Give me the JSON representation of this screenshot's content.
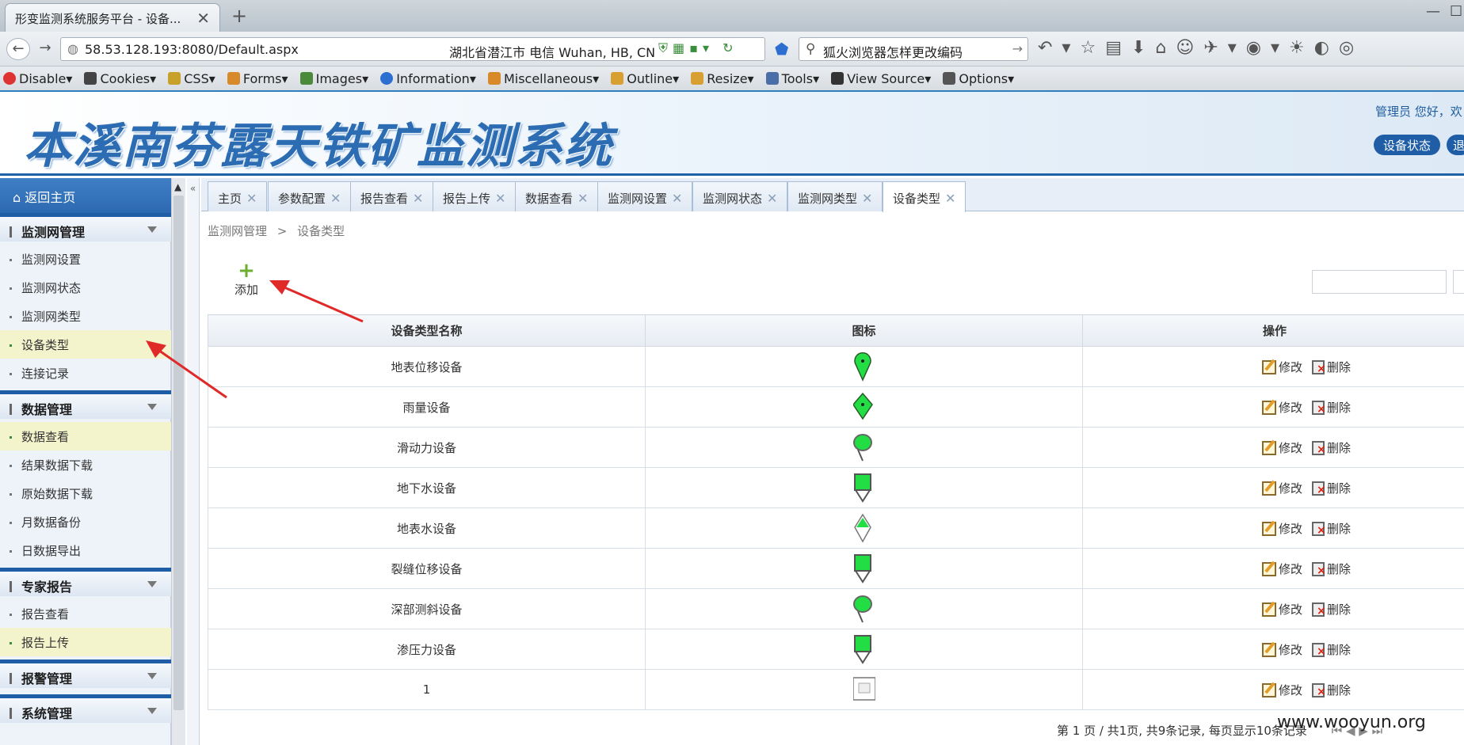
{
  "browser": {
    "tab_title": "形变监测系统服务平台 - 设备...",
    "url": "58.53.128.193:8080/Default.aspx",
    "geo": "湖北省潜江市 电信   Wuhan, HB, CN",
    "search_text": "狐火浏览器怎样更改编码",
    "dev_toolbar": [
      "Disable",
      "Cookies",
      "CSS",
      "Forms",
      "Images",
      "Information",
      "Miscellaneous",
      "Outline",
      "Resize",
      "Tools",
      "View Source",
      "Options"
    ],
    "dev_icon_colors": [
      "#d33",
      "#444",
      "#c8a12a",
      "#d88a2a",
      "#4a8a3a",
      "#2c6fd1",
      "#d8892a",
      "#d8a030",
      "#d8a030",
      "#4a6fa8",
      "#333",
      "#555"
    ]
  },
  "header": {
    "logo_text": "本溪南芬露天铁矿监测系统",
    "user_text": "管理员  您好，欢",
    "btn_status": "设备状态",
    "btn_exit": "退"
  },
  "sidebar": {
    "home": "返回主页",
    "groups": [
      {
        "label": "监测网管理",
        "items": [
          "监测网设置",
          "监测网状态",
          "监测网类型",
          "设备类型",
          "连接记录"
        ]
      },
      {
        "label": "数据管理",
        "items": [
          "数据查看",
          "结果数据下载",
          "原始数据下载",
          "月数据备份",
          "日数据导出"
        ]
      },
      {
        "label": "专家报告",
        "items": [
          "报告查看",
          "报告上传"
        ]
      },
      {
        "label": "报警管理",
        "items": []
      },
      {
        "label": "系统管理",
        "items": []
      }
    ]
  },
  "tabs": [
    "主页",
    "参数配置",
    "报告查看",
    "报告上传",
    "数据查看",
    "监测网设置",
    "监测网状态",
    "监测网类型",
    "设备类型"
  ],
  "breadcrumb": {
    "parent": "监测网管理",
    "sep": ">",
    "current": "设备类型"
  },
  "toolbar": {
    "add_label": "添加"
  },
  "grid": {
    "headers": [
      "设备类型名称",
      "图标",
      "操作"
    ],
    "edit_label": "修改",
    "delete_label": "删除",
    "rows": [
      {
        "name": "地表位移设备",
        "icon": "pin-drop-icon"
      },
      {
        "name": "雨量设备",
        "icon": "pin-diamond-icon"
      },
      {
        "name": "滑动力设备",
        "icon": "pin-oval-icon"
      },
      {
        "name": "地下水设备",
        "icon": "pin-square-icon"
      },
      {
        "name": "地表水设备",
        "icon": "pin-triangle-icon"
      },
      {
        "name": "裂缝位移设备",
        "icon": "pin-square-icon"
      },
      {
        "name": "深部测斜设备",
        "icon": "pin-oval-icon"
      },
      {
        "name": "渗压力设备",
        "icon": "pin-square-icon"
      },
      {
        "name": "1",
        "icon": "broken-image-icon"
      }
    ]
  },
  "pager": {
    "text": "第  1  页  / 共1页,    共9条记录,    每页显示10条记录"
  },
  "watermark": "www.wooyun.org",
  "colors": {
    "accent": "#1f5ea6",
    "pin_green": "#22dd44",
    "highlight": "#f3f3cc"
  }
}
